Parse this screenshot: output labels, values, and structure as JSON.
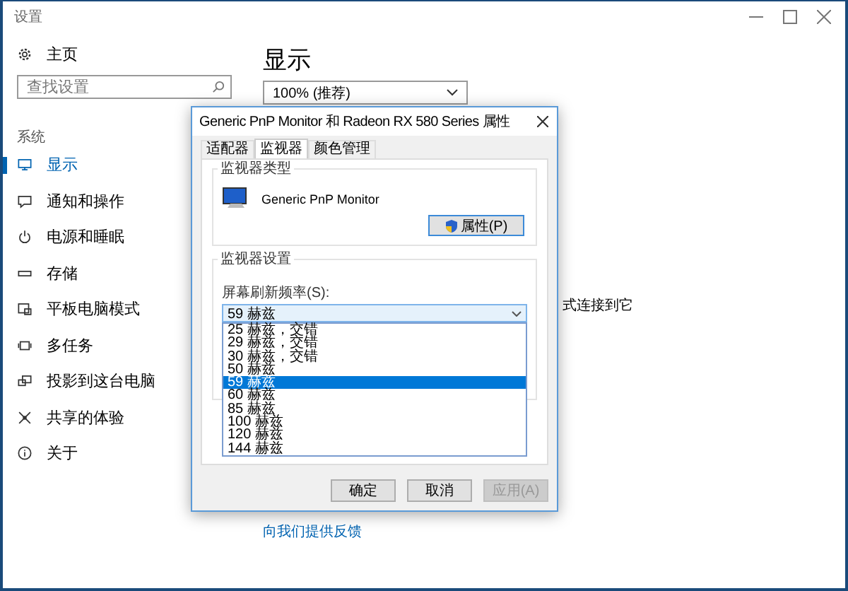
{
  "window": {
    "title": "设置"
  },
  "sidebar": {
    "home": "主页",
    "search": {
      "placeholder": "查找设置"
    },
    "section": "系统",
    "items": [
      {
        "label": "显示",
        "selected": true
      },
      {
        "label": "通知和操作",
        "selected": false
      },
      {
        "label": "电源和睡眠",
        "selected": false
      },
      {
        "label": "存储",
        "selected": false
      },
      {
        "label": "平板电脑模式",
        "selected": false
      },
      {
        "label": "多任务",
        "selected": false
      },
      {
        "label": "投影到这台电脑",
        "selected": false
      },
      {
        "label": "共享的体验",
        "selected": false
      },
      {
        "label": "关于",
        "selected": false
      }
    ]
  },
  "content": {
    "heading": "显示",
    "scale_select": {
      "value": "100% (推荐)"
    },
    "partial_text": "式连接到它",
    "feedback_link": "向我们提供反馈"
  },
  "dialog": {
    "title": "Generic PnP Monitor 和 Radeon RX 580 Series 属性",
    "tabs": [
      {
        "label": "适配器",
        "selected": false
      },
      {
        "label": "监视器",
        "selected": true
      },
      {
        "label": "颜色管理",
        "selected": false
      }
    ],
    "monitor_type": {
      "title": "监视器类型",
      "name": "Generic PnP Monitor",
      "button": "属性(P)"
    },
    "monitor_settings": {
      "title": "监视器设置",
      "refresh_label": "屏幕刷新频率(S):",
      "refresh_select": {
        "value": "59 赫兹",
        "expanded": true,
        "options": [
          {
            "label": "25 赫兹，交错",
            "selected": false
          },
          {
            "label": "29 赫兹，交错",
            "selected": false
          },
          {
            "label": "30 赫兹，交错",
            "selected": false
          },
          {
            "label": "50 赫兹",
            "selected": false
          },
          {
            "label": "59 赫兹",
            "selected": true
          },
          {
            "label": "60 赫兹",
            "selected": false
          },
          {
            "label": "85 赫兹",
            "selected": false
          },
          {
            "label": "100 赫兹",
            "selected": false
          },
          {
            "label": "120 赫兹",
            "selected": false
          },
          {
            "label": "144 赫兹",
            "selected": false
          }
        ]
      }
    },
    "buttons": [
      {
        "label": "确定",
        "disabled": false
      },
      {
        "label": "取消",
        "disabled": false
      },
      {
        "label": "应用(A)",
        "disabled": true
      }
    ]
  }
}
